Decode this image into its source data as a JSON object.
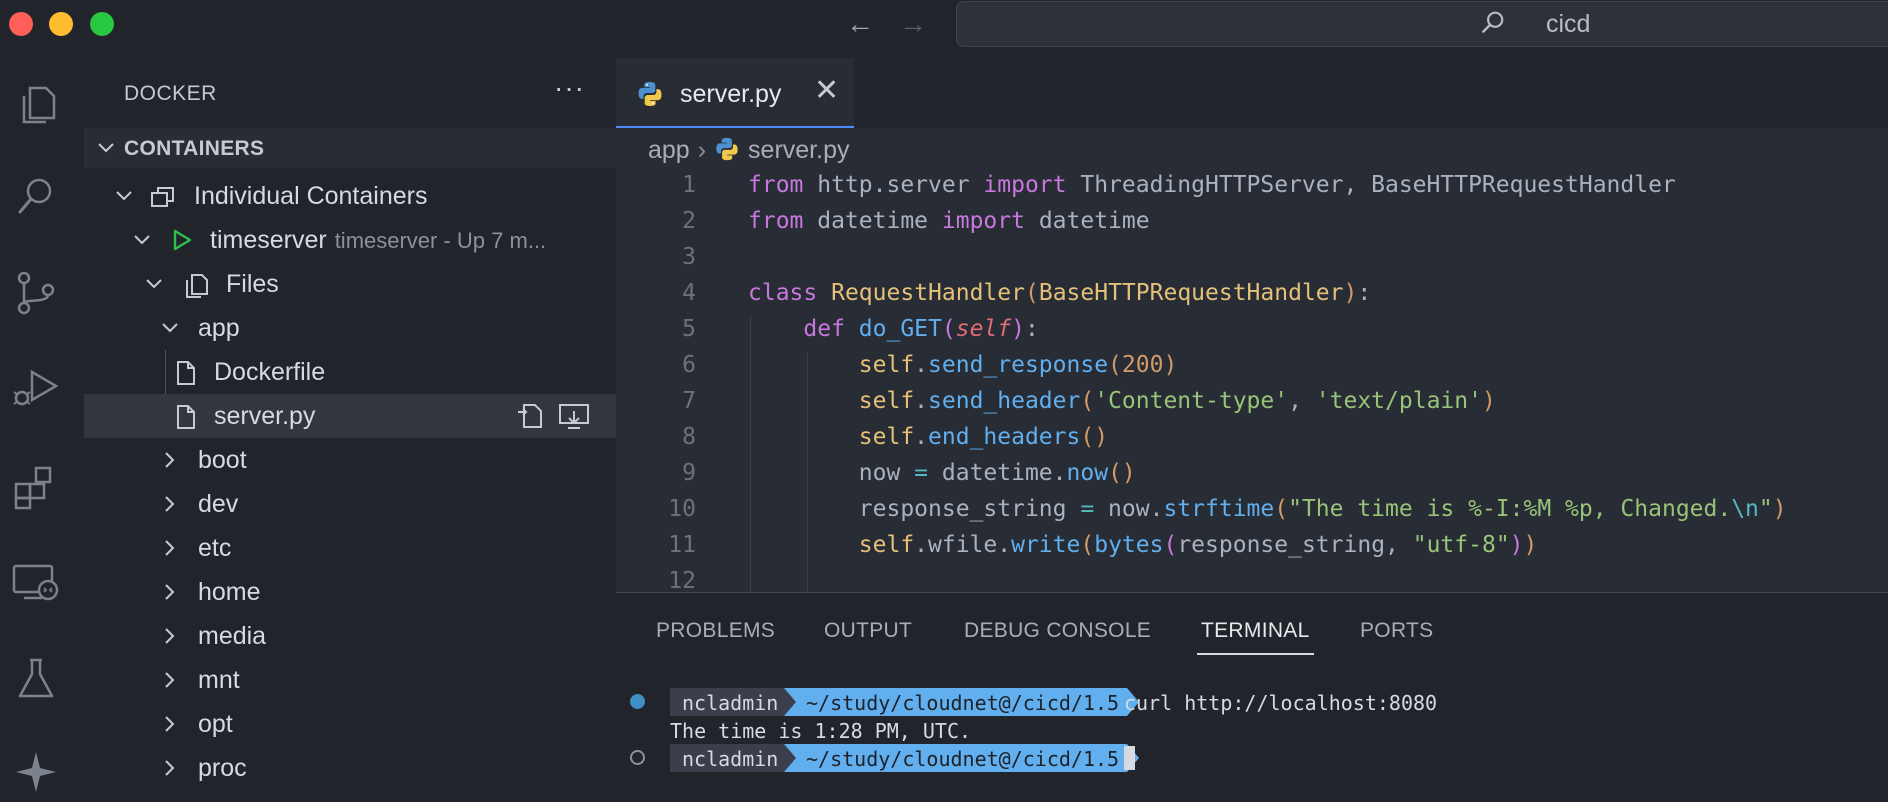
{
  "window": {
    "search_text": "cicd"
  },
  "activity_bar": {
    "items": [
      "explorer-icon",
      "search-icon",
      "source-control-icon",
      "run-debug-icon",
      "extensions-icon",
      "remote-explorer-icon",
      "testing-icon",
      "copilot-icon"
    ]
  },
  "sidebar": {
    "title": "DOCKER",
    "more": "···",
    "section": "CONTAINERS",
    "tree": {
      "group": "Individual Containers",
      "container": "timeserver",
      "container_status": "timeserver - Up 7 m...",
      "files": "Files",
      "app": "app",
      "app_files": [
        "Dockerfile",
        "server.py"
      ],
      "folders": [
        "boot",
        "dev",
        "etc",
        "home",
        "media",
        "mnt",
        "opt",
        "proc"
      ]
    }
  },
  "editor": {
    "tab_label": "server.py",
    "tab_close": "✕",
    "breadcrumb": {
      "folder": "app",
      "file": "server.py"
    },
    "line_numbers": [
      "1",
      "2",
      "3",
      "4",
      "5",
      "6",
      "7",
      "8",
      "9",
      "10",
      "11",
      "12"
    ]
  },
  "panel": {
    "tabs": [
      "PROBLEMS",
      "OUTPUT",
      "DEBUG CONSOLE",
      "TERMINAL",
      "PORTS"
    ],
    "active_tab": "TERMINAL",
    "terminal": {
      "user": "ncladmin",
      "path": "~/study/cloudnet@/cicd/1.5",
      "command": "curl http://localhost:8080",
      "output": "The time is 1:28 PM, UTC."
    }
  },
  "colors": {
    "accent": "#528bff",
    "run_green": "#2fbf4a",
    "terminal_dot": "#3d8fc6"
  }
}
